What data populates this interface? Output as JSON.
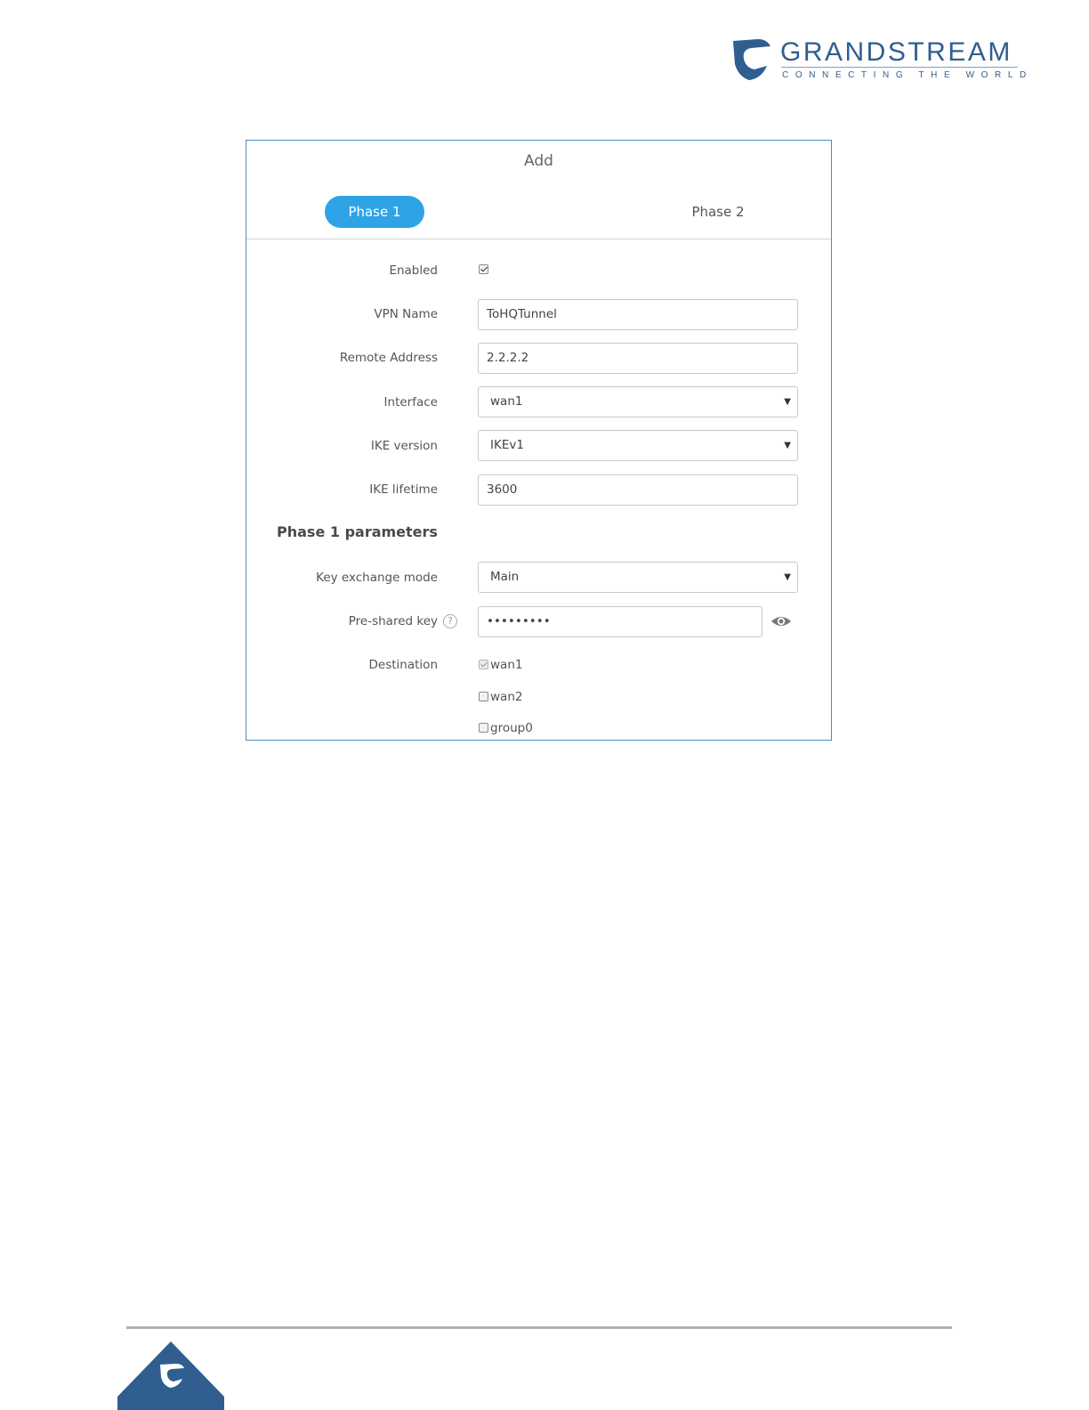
{
  "brand": {
    "name": "GRANDSTREAM",
    "tagline": "CONNECTING THE WORLD",
    "color": "#2f5e8f"
  },
  "dialog": {
    "title": "Add",
    "tabs": [
      {
        "label": "Phase 1",
        "active": true
      },
      {
        "label": "Phase 2",
        "active": false
      }
    ],
    "fields": {
      "enabled": {
        "label": "Enabled",
        "checked": true
      },
      "vpn_name": {
        "label": "VPN Name",
        "value": "ToHQTunnel"
      },
      "remote_address": {
        "label": "Remote Address",
        "value": "2.2.2.2"
      },
      "interface": {
        "label": "Interface",
        "value": "wan1"
      },
      "ike_version": {
        "label": "IKE version",
        "value": "IKEv1"
      },
      "ike_lifetime": {
        "label": "IKE lifetime",
        "value": "3600"
      }
    },
    "phase1": {
      "heading": "Phase 1 parameters",
      "key_exchange_mode": {
        "label": "Key exchange mode",
        "value": "Main"
      },
      "pre_shared_key": {
        "label": "Pre-shared key",
        "value": "•••••••••",
        "help_icon": "help-circle-icon",
        "reveal_icon": "eye-icon"
      },
      "destination": {
        "label": "Destination",
        "options": [
          {
            "label": "wan1",
            "checked": true,
            "disabled": true
          },
          {
            "label": "wan2",
            "checked": false,
            "disabled": false
          },
          {
            "label": "group0",
            "checked": false,
            "disabled": false
          }
        ]
      }
    },
    "accent_color": "#2ea3e6",
    "border_color": "#4a8cc9"
  }
}
